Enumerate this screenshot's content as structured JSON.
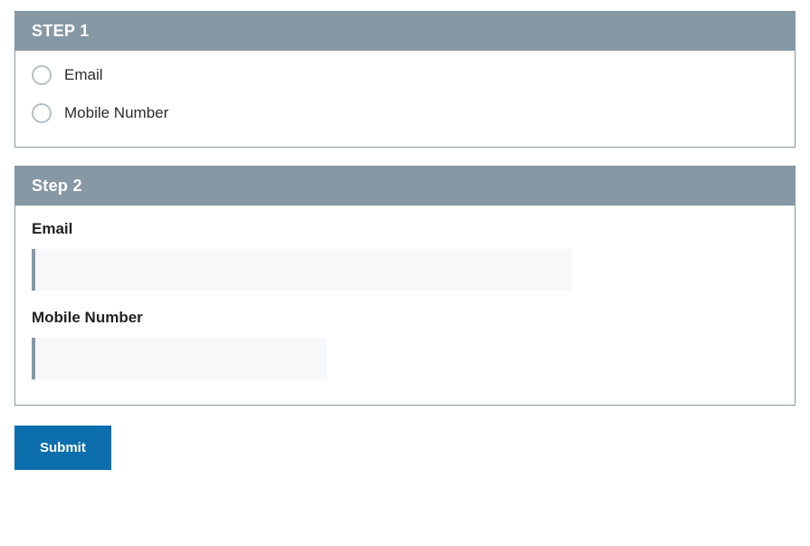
{
  "step1": {
    "title": "STEP 1",
    "options": [
      {
        "label": "Email"
      },
      {
        "label": "Mobile Number"
      }
    ]
  },
  "step2": {
    "title": "Step 2",
    "fields": {
      "email": {
        "label": "Email",
        "value": ""
      },
      "mobile": {
        "label": "Mobile Number",
        "value": ""
      }
    }
  },
  "actions": {
    "submit_label": "Submit"
  }
}
